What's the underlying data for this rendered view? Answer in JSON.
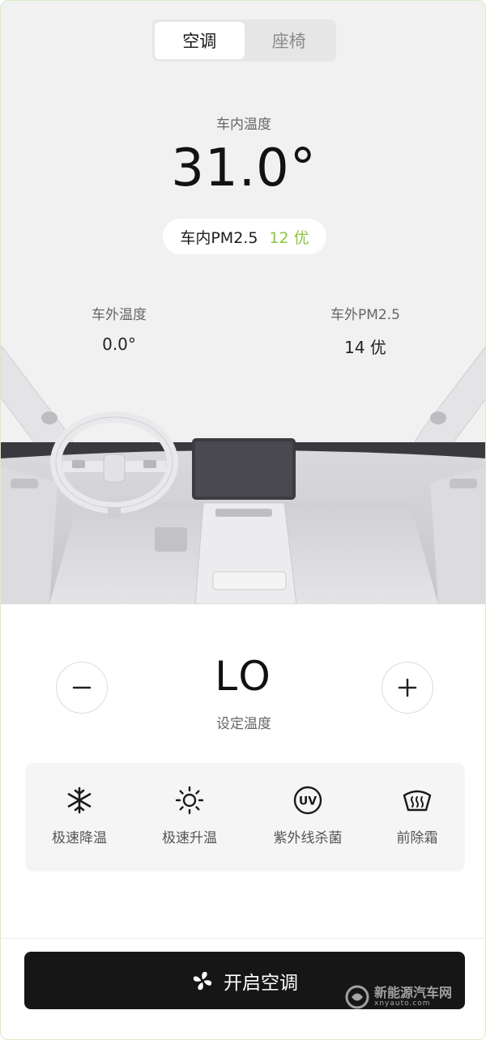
{
  "tabs": [
    {
      "label": "空调",
      "active": true
    },
    {
      "label": "座椅",
      "active": false
    }
  ],
  "cabin": {
    "temp_label": "车内温度",
    "temp_value": "31.0°",
    "pm_label": "车内PM2.5",
    "pm_value": "12 优"
  },
  "outside": {
    "temp_label": "车外温度",
    "temp_value": "0.0°",
    "pm_label": "车外PM2.5",
    "pm_value": "14 优"
  },
  "setpoint": {
    "value": "LO",
    "label": "设定温度"
  },
  "modes": [
    {
      "label": "极速降温",
      "icon": "snowflake-icon"
    },
    {
      "label": "极速升温",
      "icon": "sun-icon"
    },
    {
      "label": "紫外线杀菌",
      "icon": "uv-icon",
      "icon_text": "UV"
    },
    {
      "label": "前除霜",
      "icon": "front-defrost-icon"
    }
  ],
  "start_button": {
    "label": "开启空调",
    "icon": "fan-icon"
  },
  "watermark": {
    "main": "新能源汽车网",
    "sub": "xnyauto.com"
  },
  "colors": {
    "accent_green": "#8cc63e",
    "button_dark": "#161616"
  }
}
